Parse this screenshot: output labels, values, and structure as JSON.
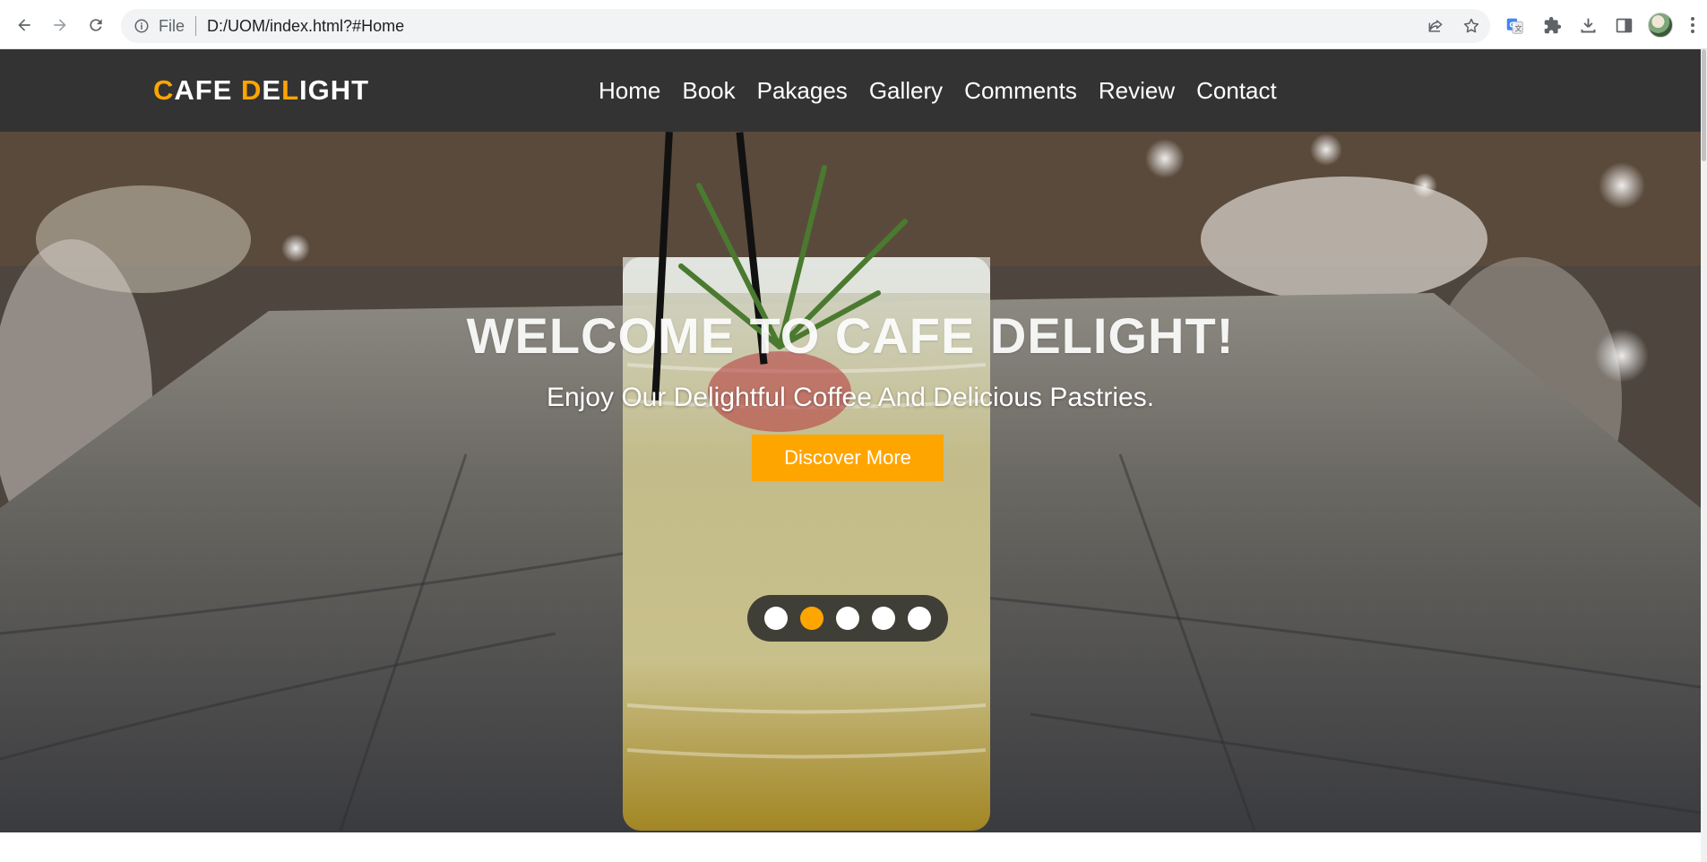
{
  "browser": {
    "address": {
      "scheme": "File",
      "url": "D:/UOM/index.html?#Home"
    },
    "icons": {
      "back": "arrow-left-icon",
      "forward": "arrow-right-icon",
      "reload": "reload-icon",
      "info": "info-icon",
      "share": "share-icon",
      "bookmark": "star-icon",
      "translate": "google-translate-icon",
      "extensions": "puzzle-icon",
      "downloads": "download-icon",
      "side_panel": "side-panel-icon",
      "profile": "avatar",
      "menu": "kebab-menu-icon"
    }
  },
  "site": {
    "logo": {
      "parts": [
        {
          "text": "C",
          "accent": true
        },
        {
          "text": "AFE ",
          "accent": false
        },
        {
          "text": "D",
          "accent": true
        },
        {
          "text": "E",
          "accent": false
        },
        {
          "text": "L",
          "accent": true
        },
        {
          "text": "IGHT",
          "accent": false
        }
      ]
    },
    "nav": [
      "Home",
      "Book",
      "Pakages",
      "Gallery",
      "Comments",
      "Review",
      "Contact"
    ],
    "hero": {
      "title": "WELCOME TO CAFE DELIGHT!",
      "subtitle": "Enjoy Our Delightful Coffee And Delicious Pastries.",
      "cta_label": "Discover More",
      "slides": 5,
      "active_slide": 2
    }
  },
  "colors": {
    "accent": "#ffa500",
    "header_bg": "#333333",
    "text_light": "#ffffff"
  }
}
